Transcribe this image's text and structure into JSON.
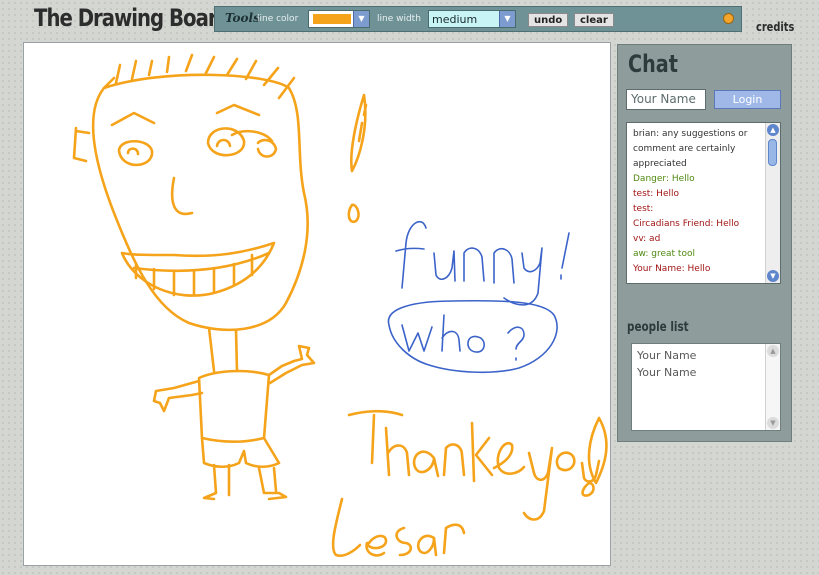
{
  "app": {
    "title": "The Drawing Board",
    "credits": "credits"
  },
  "toolbar": {
    "title": "Tools",
    "line_color_label": "line color",
    "line_color_value": "#f5a31a",
    "line_width_label": "line width",
    "line_width_value": "medium",
    "undo_label": "undo",
    "clear_label": "clear"
  },
  "canvas": {
    "texts": [
      "funny !",
      "who ?",
      "Thank you!",
      "Lesar"
    ],
    "stroke_colors": {
      "orange": "#f5a31a",
      "blue": "#3b63c9"
    }
  },
  "chat": {
    "title": "Chat",
    "name_placeholder": "Your Name",
    "login_label": "Login",
    "messages": [
      {
        "user": "brian",
        "text": "any suggestions or comment are certainly appreciated",
        "color": "#333333"
      },
      {
        "user": "Danger",
        "text": "Hello",
        "color": "#4f8a10"
      },
      {
        "user": "test",
        "text": "Hello",
        "color": "#a21616"
      },
      {
        "user": "test",
        "text": "",
        "color": "#a21616"
      },
      {
        "user": "Circadians Friend",
        "text": "Hello",
        "color": "#a21616"
      },
      {
        "user": "vv",
        "text": "ad",
        "color": "#a21616"
      },
      {
        "user": "aw",
        "text": "great tool",
        "color": "#4f8a10"
      },
      {
        "user": "Your Name",
        "text": "Hello",
        "color": "#a21616"
      }
    ]
  },
  "people": {
    "title": "people list",
    "names": [
      "Your Name",
      "Your Name"
    ]
  }
}
